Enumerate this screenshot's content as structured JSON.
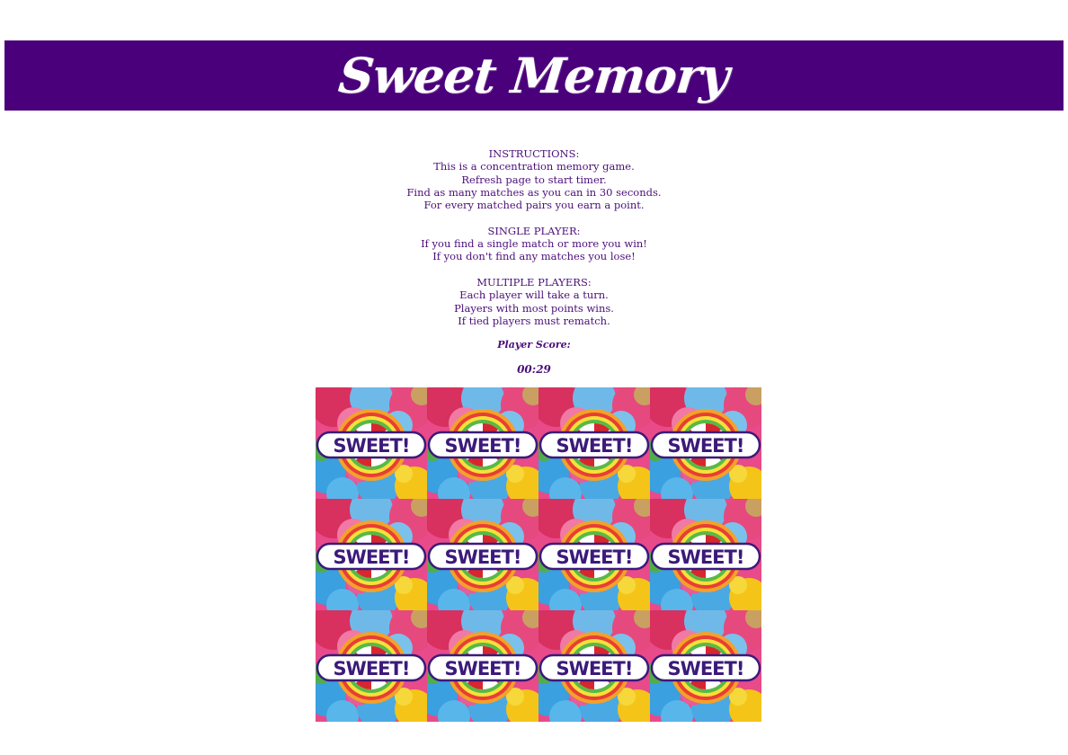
{
  "header": {
    "title": "Sweet Memory"
  },
  "instructions": {
    "section1": [
      "INSTRUCTIONS:",
      "This is a concentration memory game.",
      "Refresh page to start timer.",
      "Find as many matches as you can in 30 seconds.",
      "For every matched pairs you earn a point."
    ],
    "section2": [
      "SINGLE PLAYER:",
      "If you find a single match or more you win!",
      "If you don't find any matches you lose!"
    ],
    "section3": [
      "MULTIPLE PLAYERS:",
      "Each player will take a turn.",
      "Players with most points wins.",
      "If tied players must rematch."
    ]
  },
  "score": {
    "label": "Player Score:"
  },
  "timer": {
    "value": "00:29"
  },
  "board": {
    "rows": 3,
    "columns": 4,
    "card_back_text": "SWEET!"
  },
  "colors": {
    "banner": "#4a007a",
    "text": "#4b0f7a"
  }
}
